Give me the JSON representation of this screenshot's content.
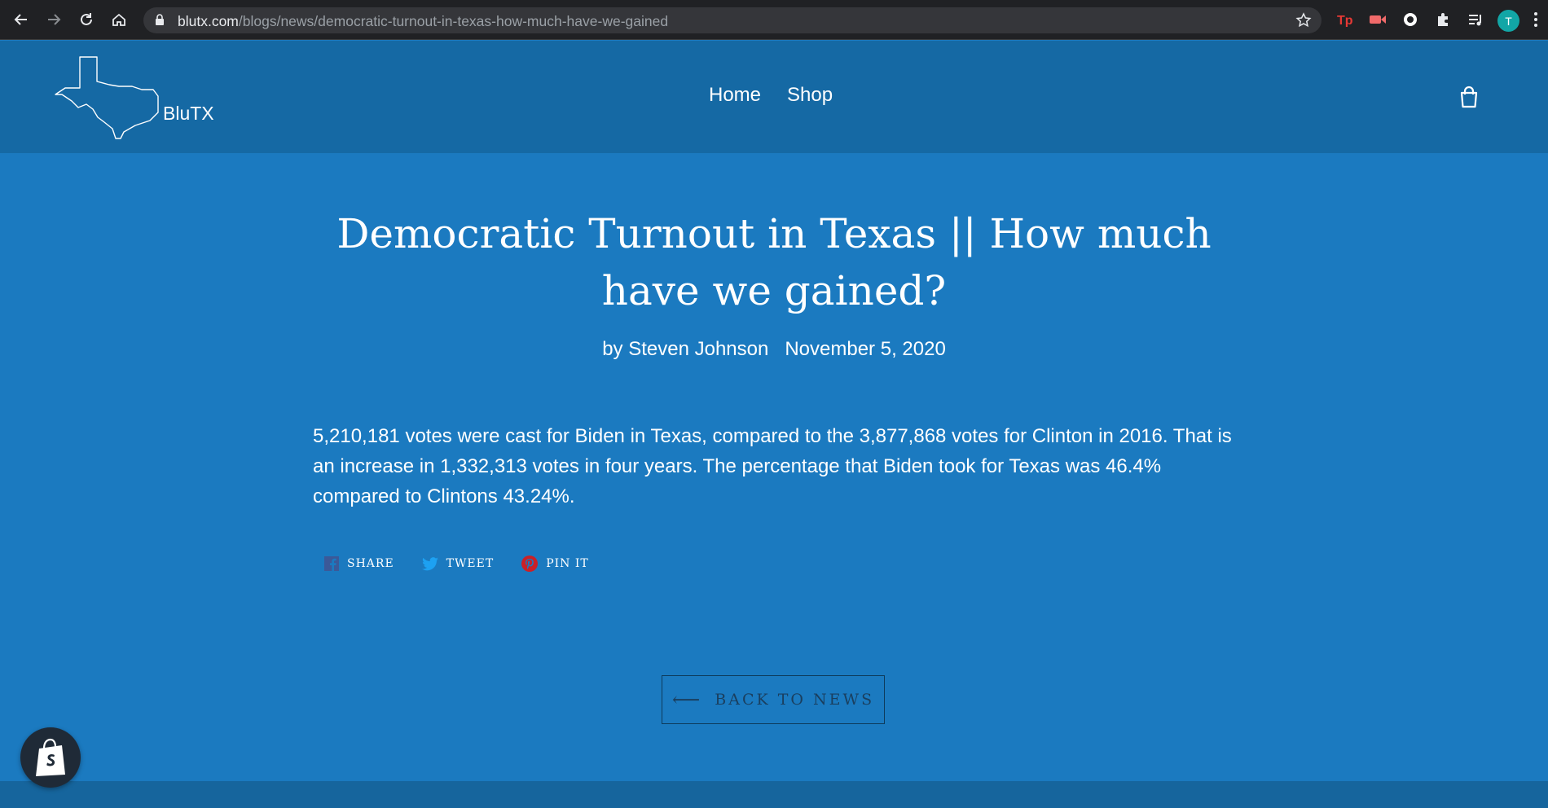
{
  "browser": {
    "url_host": "blutx.com",
    "url_path": "/blogs/news/democratic-turnout-in-texas-how-much-have-we-gained",
    "profile_initial": "T",
    "extensions": [
      "tp-extension-icon",
      "video-extension-icon",
      "circle-extension-icon",
      "puzzle-icon",
      "reading-list-icon"
    ]
  },
  "header": {
    "logo_text": "BluTX",
    "nav": [
      {
        "label": "Home"
      },
      {
        "label": "Shop"
      }
    ]
  },
  "article": {
    "title": "Democratic Turnout in Texas || How much have we gained?",
    "author": "by Steven Johnson",
    "date": "November 5, 2020",
    "body": "5,210,181 votes were cast for Biden in Texas, compared to the 3,877,868 votes for Clinton in 2016. That is an increase in 1,332,313 votes in four years. The percentage that Biden took for Texas was 46.4% compared to Clintons 43.24%."
  },
  "share": {
    "facebook_label": "SHARE",
    "twitter_label": "TWEET",
    "pinterest_label": "PIN IT"
  },
  "back_button": {
    "arrow": "⟵",
    "label": "BACK TO NEWS"
  },
  "colors": {
    "page_bg": "#1b7ac0",
    "header_bg": "#1569a4",
    "button_border": "#0d3b5c"
  }
}
